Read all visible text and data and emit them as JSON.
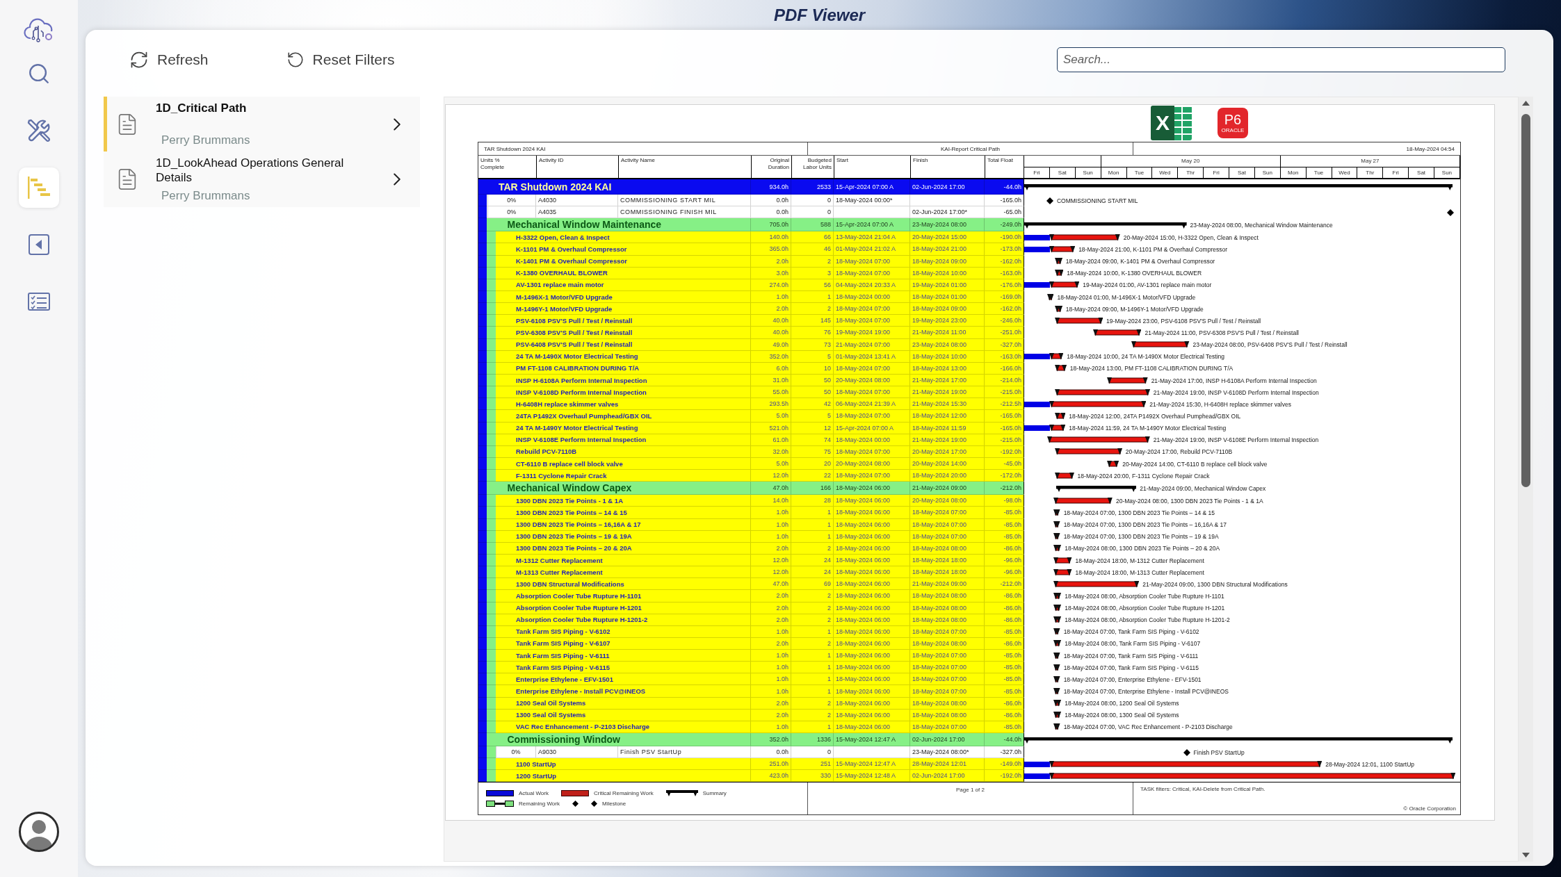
{
  "app": {
    "title": "PDF Viewer"
  },
  "nav": [
    {
      "kind": "search",
      "selected": false
    },
    {
      "kind": "tools",
      "selected": false
    },
    {
      "kind": "gantt",
      "selected": true
    },
    {
      "kind": "back",
      "selected": false
    },
    {
      "kind": "checklist",
      "selected": false
    }
  ],
  "toolbar": [
    {
      "kind": "refresh",
      "label": "Refresh"
    },
    {
      "kind": "reset",
      "label": "Reset Filters"
    }
  ],
  "search": {
    "placeholder": "Search..."
  },
  "documents": [
    {
      "title": "1D_Critical Path",
      "author": "Perry Brummans",
      "selected": true
    },
    {
      "title": "1D_LookAhead Operations General Details",
      "author": "Perry Brummans",
      "selected": false
    }
  ],
  "viewer": {
    "export_buttons": [
      {
        "kind": "excel",
        "label": "X"
      },
      {
        "kind": "p6",
        "label": "P6",
        "sublabel": "ORACLE"
      }
    ],
    "report": {
      "header": {
        "project": "TAR Shutdown 2024 KAI",
        "layout": "KAI-Report Critical Path",
        "printed": "18-May-2024 04:54"
      },
      "columns": [
        "Units % Complete",
        "Activity ID",
        "Activity Name",
        "Original Duration",
        "Budgeted Labor Units",
        "Start",
        "Finish",
        "Total Float"
      ],
      "timescale": {
        "weeks": [
          {
            "days": [
              "Fri",
              "Sat",
              "Sun"
            ]
          },
          {
            "label": "May 20",
            "days": [
              "Mon",
              "Tue",
              "Wed",
              "Thr",
              "Fri",
              "Sat",
              "Sun"
            ]
          },
          {
            "label": "May 27",
            "days": [
              "Mon",
              "Tue",
              "Wed",
              "Thr",
              "Fri",
              "Sat",
              "Sun"
            ]
          }
        ]
      },
      "rows": [
        {
          "kind": "wbs",
          "name": "TAR Shutdown 2024 KAI",
          "duration": "934.0h",
          "units": "2533",
          "start": "15-Apr-2024 07:00 A",
          "finish": "02-Jun-2024 17:00",
          "float": "-44.0h",
          "children": [
            {
              "kind": "milestone",
              "complete": "0%",
              "id": "A4030",
              "name": "COMMISSIONING START MIL",
              "duration": "0.0h",
              "units": "0",
              "start": "18-May-2024 00:00*",
              "float": "-165.0h",
              "bar_label": "COMMISSIONING START MIL"
            },
            {
              "kind": "milestone",
              "complete": "0%",
              "id": "A4035",
              "name": "COMMISSIONING FINISH MIL",
              "duration": "0.0h",
              "units": "0",
              "finish": "02-Jun-2024 17:00*",
              "float": "-65.0h"
            },
            {
              "kind": "wbs",
              "name": "Mechanical Window Maintenance",
              "duration": "705.0h",
              "units": "588",
              "start": "15-Apr-2024 07:00 A",
              "finish": "23-May-2024 08:00",
              "float": "-249.0h",
              "bar_label": "23-May-2024 08:00, Mechanical Window Maintenance",
              "children": [
                {
                  "kind": "task",
                  "name": "H-3322 Open, Clean & Inspect",
                  "duration": "140.0h",
                  "units": "66",
                  "start": "13-May-2024 21:04 A",
                  "finish": "20-May-2024 15:00",
                  "float": "-190.0h",
                  "bar_label": "20-May-2024 15:00, H-3322 Open, Clean & Inspect"
                },
                {
                  "kind": "task",
                  "name": "K-1101 PM & Overhaul Compressor",
                  "duration": "365.0h",
                  "units": "46",
                  "start": "01-May-2024 21:02 A",
                  "finish": "18-May-2024 21:00",
                  "float": "-173.0h",
                  "bar_label": "18-May-2024 21:00, K-1101 PM & Overhaul Compressor"
                },
                {
                  "kind": "task",
                  "name": "K-1401 PM & Overhaul Compressor",
                  "duration": "2.0h",
                  "units": "2",
                  "start": "18-May-2024 07:00",
                  "finish": "18-May-2024 09:00",
                  "float": "-162.0h",
                  "bar_label": "18-May-2024 09:00, K-1401 PM & Overhaul Compressor"
                },
                {
                  "kind": "task",
                  "name": "K-1380 OVERHAUL BLOWER",
                  "duration": "3.0h",
                  "units": "3",
                  "start": "18-May-2024 07:00",
                  "finish": "18-May-2024 10:00",
                  "float": "-163.0h",
                  "bar_label": "18-May-2024 10:00, K-1380 OVERHAUL BLOWER"
                },
                {
                  "kind": "task",
                  "name": "AV-1301 replace main motor",
                  "duration": "274.0h",
                  "units": "56",
                  "start": "04-May-2024 20:33 A",
                  "finish": "19-May-2024 01:00",
                  "float": "-176.0h",
                  "bar_label": "19-May-2024 01:00, AV-1301 replace main motor"
                },
                {
                  "kind": "task",
                  "name": "M-1496X-1 Motor/VFD Upgrade",
                  "duration": "1.0h",
                  "units": "1",
                  "start": "18-May-2024 00:00",
                  "finish": "18-May-2024 01:00",
                  "float": "-169.0h",
                  "bar_label": "18-May-2024 01:00, M-1496X-1 Motor/VFD Upgrade"
                },
                {
                  "kind": "task",
                  "name": "M-1496Y-1 Motor/VFD Upgrade",
                  "duration": "2.0h",
                  "units": "2",
                  "start": "18-May-2024 07:00",
                  "finish": "18-May-2024 09:00",
                  "float": "-162.0h",
                  "bar_label": "18-May-2024 09:00, M-1496Y-1 Motor/VFD Upgrade"
                },
                {
                  "kind": "task",
                  "name": "PSV-6108 PSV'S Pull / Test / Reinstall",
                  "duration": "40.0h",
                  "units": "145",
                  "start": "18-May-2024 07:00",
                  "finish": "19-May-2024 23:00",
                  "float": "-246.0h",
                  "bar_label": "19-May-2024 23:00, PSV-6108 PSV'S Pull / Test / Reinstall"
                },
                {
                  "kind": "task",
                  "name": "PSV-6308 PSV'S Pull / Test / Reinstall",
                  "duration": "40.0h",
                  "units": "76",
                  "start": "19-May-2024 19:00",
                  "finish": "21-May-2024 11:00",
                  "float": "-251.0h",
                  "bar_label": "21-May-2024 11:00, PSV-6308 PSV'S Pull / Test / Reinstall"
                },
                {
                  "kind": "task",
                  "name": "PSV-6408 PSV'S Pull / Test / Reinstall",
                  "duration": "49.0h",
                  "units": "73",
                  "start": "21-May-2024 07:00",
                  "finish": "23-May-2024 08:00",
                  "float": "-327.0h",
                  "bar_label": "23-May-2024 08:00, PSV-6408 PSV'S Pull / Test / Reinstall"
                },
                {
                  "kind": "task",
                  "name": "24 TA M-1490X Motor Electrical Testing",
                  "duration": "352.0h",
                  "units": "5",
                  "start": "01-May-2024 13:41 A",
                  "finish": "18-May-2024 10:00",
                  "float": "-163.0h",
                  "bar_label": "18-May-2024 10:00, 24 TA M-1490X Motor Electrical Testing"
                },
                {
                  "kind": "task",
                  "name": "PM FT-1108 CALIBRATION DURING T/A",
                  "duration": "6.0h",
                  "units": "10",
                  "start": "18-May-2024 07:00",
                  "finish": "18-May-2024 13:00",
                  "float": "-166.0h",
                  "bar_label": "18-May-2024 13:00, PM FT-1108 CALIBRATION DURING T/A"
                },
                {
                  "kind": "task",
                  "name": "INSP H-6108A Perform Internal Inspection",
                  "duration": "31.0h",
                  "units": "50",
                  "start": "20-May-2024 08:00",
                  "finish": "21-May-2024 17:00",
                  "float": "-214.0h",
                  "bar_label": "21-May-2024 17:00, INSP H-6108A Perform Internal Inspection"
                },
                {
                  "kind": "task",
                  "name": "INSP V-6108D Perform Internal Inspection",
                  "duration": "55.0h",
                  "units": "50",
                  "start": "18-May-2024 07:00",
                  "finish": "21-May-2024 19:00",
                  "float": "-215.0h",
                  "bar_label": "21-May-2024 19:00, INSP V-6108D Perform Internal Inspection"
                },
                {
                  "kind": "task",
                  "name": "H-6408H replace skimmer valves",
                  "duration": "293.5h",
                  "units": "42",
                  "start": "06-May-2024 21:39 A",
                  "finish": "21-May-2024 15:30",
                  "float": "-212.5h",
                  "bar_label": "21-May-2024 15:30, H-6408H replace skimmer valves"
                },
                {
                  "kind": "task",
                  "name": "24TA P1492X Overhaul Pumphead/GBX OIL",
                  "duration": "5.0h",
                  "units": "5",
                  "start": "18-May-2024 07:00",
                  "finish": "18-May-2024 12:00",
                  "float": "-165.0h",
                  "bar_label": "18-May-2024 12:00, 24TA P1492X Overhaul Pumphead/GBX OIL"
                },
                {
                  "kind": "task",
                  "name": "24 TA M-1490Y Motor Electrical Testing",
                  "duration": "521.0h",
                  "units": "12",
                  "start": "15-Apr-2024 07:00 A",
                  "finish": "18-May-2024 11:59",
                  "float": "-165.0h",
                  "bar_label": "18-May-2024 11:59, 24 TA M-1490Y Motor Electrical Testing"
                },
                {
                  "kind": "task",
                  "name": "INSP V-6108E Perform Internal Inspection",
                  "duration": "61.0h",
                  "units": "74",
                  "start": "18-May-2024 00:00",
                  "finish": "21-May-2024 19:00",
                  "float": "-215.0h",
                  "bar_label": "21-May-2024 19:00, INSP V-6108E Perform Internal Inspection"
                },
                {
                  "kind": "task",
                  "name": "Rebuild PCV-7110B",
                  "duration": "32.0h",
                  "units": "75",
                  "start": "18-May-2024 07:00",
                  "finish": "20-May-2024 17:00",
                  "float": "-192.0h",
                  "bar_label": "20-May-2024 17:00, Rebuild PCV-7110B"
                },
                {
                  "kind": "task",
                  "name": "CT-6110 B replace cell block valve",
                  "duration": "5.0h",
                  "units": "20",
                  "start": "20-May-2024 08:00",
                  "finish": "20-May-2024 14:00",
                  "float": "-45.0h",
                  "bar_label": "20-May-2024 14:00, CT-6110 B replace cell block valve"
                },
                {
                  "kind": "task",
                  "name": "F-1311 Cyclone Repair Crack",
                  "duration": "12.0h",
                  "units": "22",
                  "start": "18-May-2024 07:00",
                  "finish": "18-May-2024 20:00",
                  "float": "-172.0h",
                  "bar_label": "18-May-2024 20:00, F-1311 Cyclone Repair Crack"
                }
              ]
            },
            {
              "kind": "wbs",
              "name": "Mechanical Window Capex",
              "duration": "47.0h",
              "units": "166",
              "start": "18-May-2024 06:00",
              "finish": "21-May-2024 09:00",
              "float": "-212.0h",
              "bar_label": "21-May-2024 09:00, Mechanical Window Capex",
              "children": [
                {
                  "kind": "task",
                  "name": "1300 DBN 2023 Tie Points - 1 & 1A",
                  "duration": "14.0h",
                  "units": "28",
                  "start": "18-May-2024 06:00",
                  "finish": "20-May-2024 08:00",
                  "float": "-98.0h",
                  "bar_label": "20-May-2024 08:00, 1300 DBN 2023 Tie Points - 1 & 1A"
                },
                {
                  "kind": "task",
                  "name": "1300 DBN 2023 Tie Points – 14 & 15",
                  "duration": "1.0h",
                  "units": "1",
                  "start": "18-May-2024 06:00",
                  "finish": "18-May-2024 07:00",
                  "float": "-85.0h",
                  "bar_label": "18-May-2024 07:00, 1300 DBN 2023 Tie Points – 14 & 15"
                },
                {
                  "kind": "task",
                  "name": "1300 DBN 2023 Tie Points – 16,16A & 17",
                  "duration": "1.0h",
                  "units": "1",
                  "start": "18-May-2024 06:00",
                  "finish": "18-May-2024 07:00",
                  "float": "-85.0h",
                  "bar_label": "18-May-2024 07:00, 1300 DBN 2023 Tie Points – 16,16A & 17"
                },
                {
                  "kind": "task",
                  "name": "1300 DBN 2023 Tie Points – 19 & 19A",
                  "duration": "1.0h",
                  "units": "1",
                  "start": "18-May-2024 06:00",
                  "finish": "18-May-2024 07:00",
                  "float": "-85.0h",
                  "bar_label": "18-May-2024 07:00, 1300 DBN 2023 Tie Points – 19 & 19A"
                },
                {
                  "kind": "task",
                  "name": "1300 DBN 2023 Tie Points – 20 & 20A",
                  "duration": "2.0h",
                  "units": "2",
                  "start": "18-May-2024 06:00",
                  "finish": "18-May-2024 08:00",
                  "float": "-86.0h",
                  "bar_label": "18-May-2024 08:00, 1300 DBN 2023 Tie Points – 20 & 20A"
                },
                {
                  "kind": "task",
                  "name": "M-1312 Cutter Replacement",
                  "duration": "12.0h",
                  "units": "24",
                  "start": "18-May-2024 06:00",
                  "finish": "18-May-2024 18:00",
                  "float": "-96.0h",
                  "bar_label": "18-May-2024 18:00, M-1312 Cutter Replacement"
                },
                {
                  "kind": "task",
                  "name": "M-1313 Cutter Replacement",
                  "duration": "12.0h",
                  "units": "24",
                  "start": "18-May-2024 06:00",
                  "finish": "18-May-2024 18:00",
                  "float": "-96.0h",
                  "bar_label": "18-May-2024 18:00, M-1313 Cutter Replacement"
                },
                {
                  "kind": "task",
                  "name": "1300 DBN Structural Modifications",
                  "duration": "47.0h",
                  "units": "69",
                  "start": "18-May-2024 06:00",
                  "finish": "21-May-2024 09:00",
                  "float": "-212.0h",
                  "bar_label": "21-May-2024 09:00, 1300 DBN Structural Modifications"
                },
                {
                  "kind": "task",
                  "name": "Absorption Cooler Tube Rupture H-1101",
                  "duration": "2.0h",
                  "units": "2",
                  "start": "18-May-2024 06:00",
                  "finish": "18-May-2024 08:00",
                  "float": "-86.0h",
                  "bar_label": "18-May-2024 08:00, Absorption Cooler Tube Rupture H-1101"
                },
                {
                  "kind": "task",
                  "name": "Absorption Cooler Tube Rupture H-1201",
                  "duration": "2.0h",
                  "units": "2",
                  "start": "18-May-2024 06:00",
                  "finish": "18-May-2024 08:00",
                  "float": "-86.0h",
                  "bar_label": "18-May-2024 08:00, Absorption Cooler Tube Rupture H-1201"
                },
                {
                  "kind": "task",
                  "name": "Absorption Cooler Tube Rupture H-1201-2",
                  "duration": "2.0h",
                  "units": "2",
                  "start": "18-May-2024 06:00",
                  "finish": "18-May-2024 08:00",
                  "float": "-86.0h",
                  "bar_label": "18-May-2024 08:00, Absorption Cooler Tube Rupture H-1201-2"
                },
                {
                  "kind": "task",
                  "name": "Tank Farm SIS Piping - V-6102",
                  "duration": "1.0h",
                  "units": "1",
                  "start": "18-May-2024 06:00",
                  "finish": "18-May-2024 07:00",
                  "float": "-85.0h",
                  "bar_label": "18-May-2024 07:00, Tank Farm SIS Piping - V-6102"
                },
                {
                  "kind": "task",
                  "name": "Tank Farm SIS Piping - V-6107",
                  "duration": "2.0h",
                  "units": "2",
                  "start": "18-May-2024 06:00",
                  "finish": "18-May-2024 08:00",
                  "float": "-86.0h",
                  "bar_label": "18-May-2024 08:00, Tank Farm SIS Piping - V-6107"
                },
                {
                  "kind": "task",
                  "name": "Tank Farm SIS Piping - V-6111",
                  "duration": "1.0h",
                  "units": "1",
                  "start": "18-May-2024 06:00",
                  "finish": "18-May-2024 07:00",
                  "float": "-85.0h",
                  "bar_label": "18-May-2024 07:00, Tank Farm SIS Piping - V-6111"
                },
                {
                  "kind": "task",
                  "name": "Tank Farm SIS Piping - V-6115",
                  "duration": "1.0h",
                  "units": "1",
                  "start": "18-May-2024 06:00",
                  "finish": "18-May-2024 07:00",
                  "float": "-85.0h",
                  "bar_label": "18-May-2024 07:00, Tank Farm SIS Piping - V-6115"
                },
                {
                  "kind": "task",
                  "name": "Enterprise Ethylene - EFV-1501",
                  "duration": "1.0h",
                  "units": "1",
                  "start": "18-May-2024 06:00",
                  "finish": "18-May-2024 07:00",
                  "float": "-85.0h",
                  "bar_label": "18-May-2024 07:00, Enterprise Ethylene - EFV-1501"
                },
                {
                  "kind": "task",
                  "name": "Enterprise Ethylene - Install PCV@INEOS",
                  "duration": "1.0h",
                  "units": "1",
                  "start": "18-May-2024 06:00",
                  "finish": "18-May-2024 07:00",
                  "float": "-85.0h",
                  "bar_label": "18-May-2024 07:00, Enterprise Ethylene - Install PCV@INEOS"
                },
                {
                  "kind": "task",
                  "name": "1200 Seal Oil Systems",
                  "duration": "2.0h",
                  "units": "2",
                  "start": "18-May-2024 06:00",
                  "finish": "18-May-2024 08:00",
                  "float": "-86.0h",
                  "bar_label": "18-May-2024 08:00, 1200 Seal Oil Systems"
                },
                {
                  "kind": "task",
                  "name": "1300 Seal Oil Systems",
                  "duration": "2.0h",
                  "units": "2",
                  "start": "18-May-2024 06:00",
                  "finish": "18-May-2024 08:00",
                  "float": "-86.0h",
                  "bar_label": "18-May-2024 08:00, 1300 Seal Oil Systems"
                },
                {
                  "kind": "task",
                  "name": "VAC Rec Enhancement - P-2103 Discharge",
                  "duration": "1.0h",
                  "units": "1",
                  "start": "18-May-2024 06:00",
                  "finish": "18-May-2024 07:00",
                  "float": "-85.0h",
                  "bar_label": "18-May-2024 07:00, VAC Rec Enhancement - P-2103 Discharge"
                }
              ]
            },
            {
              "kind": "wbs",
              "name": "Commissioning Window",
              "duration": "352.0h",
              "units": "1336",
              "start": "15-May-2024 12:47 A",
              "finish": "02-Jun-2024 17:00",
              "float": "-44.0h",
              "children": [
                {
                  "kind": "milestone",
                  "complete": "0%",
                  "id": "A9030",
                  "name": "Finish PSV StartUp",
                  "duration": "0.0h",
                  "units": "0",
                  "finish": "23-May-2024 08:00*",
                  "float": "-327.0h",
                  "bar_label": "Finish PSV StartUp"
                },
                {
                  "kind": "task",
                  "name": "1100 StartUp",
                  "duration": "251.0h",
                  "units": "251",
                  "start": "15-May-2024 12:47 A",
                  "finish": "28-May-2024 12:01",
                  "float": "-149.0h",
                  "bar_label": "28-May-2024 12:01, 1100 StartUp"
                },
                {
                  "kind": "task",
                  "name": "1200 StartUp",
                  "duration": "423.0h",
                  "units": "330",
                  "start": "15-May-2024 12:48 A",
                  "finish": "02-Jun-2024 17:00",
                  "float": "-192.0h"
                }
              ]
            }
          ]
        }
      ],
      "footer": {
        "legend": [
          {
            "items": [
              {
                "kind": "actual",
                "label": "Actual Work"
              },
              {
                "kind": "critical",
                "label": "Critical Remaining Work"
              },
              {
                "kind": "summary",
                "label": "Summary"
              }
            ]
          },
          {
            "items": [
              {
                "kind": "remaining",
                "label": "Remaining Work"
              },
              {
                "kind": "marker"
              },
              {
                "kind": "milestone",
                "label": "Milestone"
              }
            ]
          }
        ],
        "page": "Page 1 of 2",
        "filters": "TASK filters: Critical, KAI-Delete from Critical Path.",
        "copyright": "© Oracle Corporation"
      }
    }
  }
}
